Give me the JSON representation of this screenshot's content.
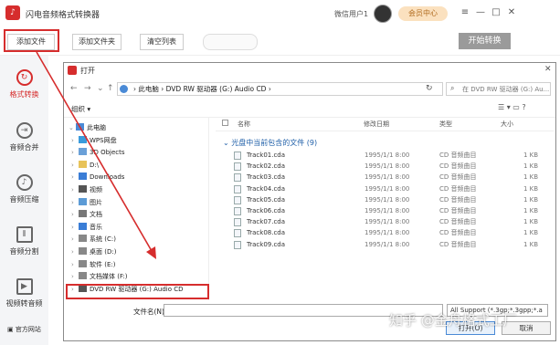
{
  "app": {
    "title": "闪电音频格式转换器",
    "user_label": "微信用户1",
    "vip_label": "会员中心",
    "min_glyph": "—",
    "max_glyph": "□",
    "close_glyph": "✕",
    "menu_glyph": "≡"
  },
  "toolbar": {
    "add_file": "添加文件",
    "add_folder": "添加文件夹",
    "clear_list": "清空列表",
    "start_convert": "开始转换"
  },
  "sidebar": {
    "items": [
      {
        "label": "格式转换",
        "icon": "refresh-icon"
      },
      {
        "label": "音频合并",
        "icon": "merge-icon"
      },
      {
        "label": "音频压缩",
        "icon": "compress-icon"
      },
      {
        "label": "音频分割",
        "icon": "split-icon"
      },
      {
        "label": "视频转音频",
        "icon": "video-icon"
      }
    ],
    "footer_link": "官方网站"
  },
  "dialog": {
    "title": "打开",
    "address": "›  此电脑  ›  DVD RW 驱动器 (G:) Audio CD  ›",
    "search_placeholder": "在 DVD RW 驱动器 (G:) Au...",
    "organize": "组织 ▾",
    "tree": [
      {
        "label": "此电脑",
        "icon": "pc-icon"
      },
      {
        "label": "WPS网盘",
        "icon": "cloud-icon"
      },
      {
        "label": "3D Objects",
        "icon": "cube-icon"
      },
      {
        "label": "D:\\",
        "icon": "folder-icon"
      },
      {
        "label": "Downloads",
        "icon": "download-icon"
      },
      {
        "label": "视频",
        "icon": "video-folder-icon"
      },
      {
        "label": "图片",
        "icon": "picture-folder-icon"
      },
      {
        "label": "文档",
        "icon": "document-folder-icon"
      },
      {
        "label": "音乐",
        "icon": "music-folder-icon"
      },
      {
        "label": "系统 (C:)",
        "icon": "drive-icon"
      },
      {
        "label": "桌面 (D:)",
        "icon": "drive-icon"
      },
      {
        "label": "软件 (E:)",
        "icon": "drive-icon"
      },
      {
        "label": "文档媒体 (F:)",
        "icon": "drive-icon"
      },
      {
        "label": "DVD RW 驱动器 (G:) Audio CD",
        "icon": "dvd-icon"
      }
    ],
    "columns": {
      "name": "名称",
      "date": "修改日期",
      "type": "类型",
      "size": "大小"
    },
    "group_label": "光盘中当前包含的文件 (9)",
    "files": [
      {
        "name": "Track01.cda",
        "date": "1995/1/1 8:00",
        "type": "CD 音频曲目",
        "size": "1 KB"
      },
      {
        "name": "Track02.cda",
        "date": "1995/1/1 8:00",
        "type": "CD 音频曲目",
        "size": "1 KB"
      },
      {
        "name": "Track03.cda",
        "date": "1995/1/1 8:00",
        "type": "CD 音频曲目",
        "size": "1 KB"
      },
      {
        "name": "Track04.cda",
        "date": "1995/1/1 8:00",
        "type": "CD 音频曲目",
        "size": "1 KB"
      },
      {
        "name": "Track05.cda",
        "date": "1995/1/1 8:00",
        "type": "CD 音频曲目",
        "size": "1 KB"
      },
      {
        "name": "Track06.cda",
        "date": "1995/1/1 8:00",
        "type": "CD 音频曲目",
        "size": "1 KB"
      },
      {
        "name": "Track07.cda",
        "date": "1995/1/1 8:00",
        "type": "CD 音频曲目",
        "size": "1 KB"
      },
      {
        "name": "Track08.cda",
        "date": "1995/1/1 8:00",
        "type": "CD 音频曲目",
        "size": "1 KB"
      },
      {
        "name": "Track09.cda",
        "date": "1995/1/1 8:00",
        "type": "CD 音频曲目",
        "size": "1 KB"
      }
    ],
    "filename_label": "文件名(N):",
    "filename_value": "",
    "filter_value": "All Support (*.3gp;*.3gpp;*.a",
    "open_label": "打开(O)",
    "cancel_label": "取消"
  },
  "watermark": "知乎 @金舟格式工厂",
  "colors": {
    "accent": "#d62d2d",
    "link": "#1f5fa8"
  }
}
